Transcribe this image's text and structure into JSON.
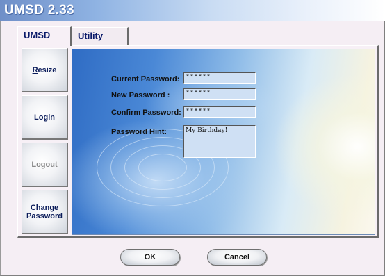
{
  "window": {
    "title": "UMSD 2.33"
  },
  "tabs": [
    {
      "label": "UMSD",
      "active": true
    },
    {
      "label": "Utility",
      "active": false
    }
  ],
  "sidebar": {
    "items": [
      {
        "pre": "",
        "ul": "R",
        "post": "esize",
        "enabled": true
      },
      {
        "pre": "Login",
        "ul": "",
        "post": "",
        "enabled": true
      },
      {
        "pre": "Log",
        "ul": "o",
        "post": "ut",
        "enabled": false
      },
      {
        "pre": "",
        "ul": "C",
        "post": "hange\nPassword",
        "enabled": true
      }
    ]
  },
  "form": {
    "current_password": {
      "label": "Current Password:",
      "value": "******"
    },
    "new_password": {
      "label": "New Password :",
      "value": "******"
    },
    "confirm_password": {
      "label": "Confirm Password:",
      "value": "******"
    },
    "password_hint": {
      "label": "Password Hint:",
      "value": "My Birthday!"
    }
  },
  "footer": {
    "ok_label": "OK",
    "cancel_label": "Cancel"
  },
  "colors": {
    "field_bg": "#cfe0f4",
    "label_text": "#0b1c5a"
  }
}
